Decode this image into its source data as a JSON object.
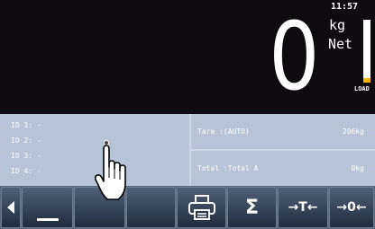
{
  "display": {
    "time": "11:57",
    "weight": "0",
    "unit": "kg",
    "mode": "Net",
    "load_label": "LOAD",
    "load_level": 0.07,
    "load_fill_color": "#f2b500"
  },
  "ids": [
    {
      "label": "ID 1:",
      "value": "-"
    },
    {
      "label": "ID 2:",
      "value": "-"
    },
    {
      "label": "ID 3:",
      "value": "-"
    },
    {
      "label": "ID 4:",
      "value": "-"
    }
  ],
  "tare": {
    "label": "Tare  :(AUTO)",
    "value": "206kg"
  },
  "total": {
    "label": "Total :Total A",
    "value": "0kg"
  },
  "softkeys": [
    {
      "name": "left-arrow-icon"
    },
    {
      "name": "underscore-icon"
    },
    {
      "name": "blank"
    },
    {
      "name": "blank"
    },
    {
      "name": "printer-icon"
    },
    {
      "name": "sigma",
      "label": "Σ"
    },
    {
      "name": "tare-icon",
      "label": "→T←"
    },
    {
      "name": "zero-icon",
      "label": "→0←"
    }
  ],
  "colors": {
    "display_bg": "#0d0b0e",
    "info_bg": "#b7c4d8",
    "key_bg": "#1f2c3d"
  },
  "overlay": {
    "icon": "hand-pointer-icon"
  }
}
